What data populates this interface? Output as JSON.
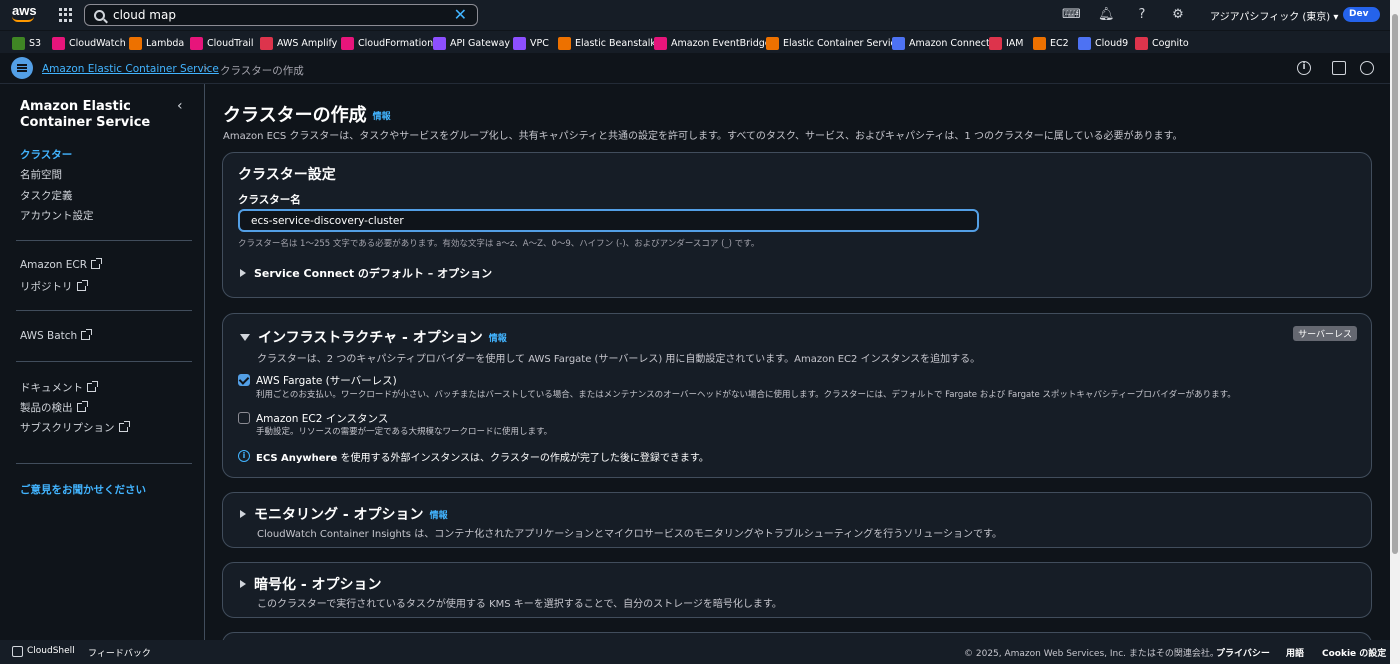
{
  "topnav": {
    "logo": "aws",
    "search_value": "cloud map",
    "region": "アジアパシフィック (東京) ▾",
    "account_badge": "Dev"
  },
  "favorites": [
    {
      "label": "S3",
      "color": "#3f8624"
    },
    {
      "label": "CloudWatch",
      "color": "#e7157b"
    },
    {
      "label": "Lambda",
      "color": "#ed7100"
    },
    {
      "label": "CloudTrail",
      "color": "#e7157b"
    },
    {
      "label": "AWS Amplify",
      "color": "#dd344c"
    },
    {
      "label": "CloudFormation",
      "color": "#e7157b"
    },
    {
      "label": "API Gateway",
      "color": "#8c4fff"
    },
    {
      "label": "VPC",
      "color": "#8c4fff"
    },
    {
      "label": "Elastic Beanstalk",
      "color": "#ed7100"
    },
    {
      "label": "Amazon EventBridge",
      "color": "#e7157b"
    },
    {
      "label": "Elastic Container Service",
      "color": "#ed7100"
    },
    {
      "label": "Amazon Connect",
      "color": "#4d72f3"
    },
    {
      "label": "IAM",
      "color": "#dd344c"
    },
    {
      "label": "EC2",
      "color": "#ed7100"
    },
    {
      "label": "Cloud9",
      "color": "#4d72f3"
    },
    {
      "label": "Cognito",
      "color": "#dd344c"
    }
  ],
  "breadcrumb": {
    "parent": "Amazon Elastic Container Service",
    "separator": "›",
    "current": "クラスターの作成"
  },
  "sidebar": {
    "title": "Amazon Elastic Container Service",
    "close": "‹",
    "items": [
      {
        "label": "クラスター"
      },
      {
        "label": "名前空間"
      },
      {
        "label": "タスク定義"
      },
      {
        "label": "アカウント設定"
      },
      {
        "label": "Amazon ECR"
      },
      {
        "label": "リポジトリ"
      },
      {
        "label": "AWS Batch"
      },
      {
        "label": "ドキュメント"
      },
      {
        "label": "製品の検出"
      },
      {
        "label": "サブスクリプション"
      }
    ],
    "feedback": "ご意見をお聞かせください"
  },
  "main": {
    "title": "クラスターの作成",
    "info": "情報",
    "description": "Amazon ECS クラスターは、タスクやサービスをグループ化し、共有キャパシティと共通の設定を許可します。すべてのタスク、サービス、およびキャパシティは、1 つのクラスターに属している必要があります。",
    "cluster_settings": {
      "title": "クラスター設定",
      "name_label": "クラスター名",
      "name_value": "ecs-service-discovery-cluster",
      "name_hint": "クラスター名は 1～255 文字である必要があります。有効な文字は a～z、A～Z、0～9、ハイフン (-)、およびアンダースコア (_) です。",
      "service_connect": "Service Connect のデフォルト – オプション"
    },
    "infra": {
      "title": "インフラストラクチャ - オプション",
      "info": "情報",
      "badge": "サーバーレス",
      "description": "クラスターは、2 つのキャパシティプロバイダーを使用して AWS Fargate (サーバーレス) 用に自動設定されています。Amazon EC2 インスタンスを追加する。",
      "fargate_label": "AWS Fargate (サーバーレス)",
      "fargate_desc": "利用ごとのお支払い。ワークロードが小さい、バッチまたはバーストしている場合、またはメンテナンスのオーバーヘッドがない場合に使用します。クラスターには、デフォルトで Fargate および Fargate スポットキャパシティープロバイダーがあります。",
      "fargate_checked": true,
      "ec2_label": "Amazon EC2 インスタンス",
      "ec2_desc": "手動設定。リソースの需要が一定である大規模なワークロードに使用します。",
      "ec2_checked": false,
      "anywhere_strong": "ECS Anywhere",
      "anywhere_text": " を使用する外部インスタンスは、クラスターの作成が完了した後に登録できます。"
    },
    "monitoring": {
      "title": "モニタリング - オプション",
      "info": "情報",
      "description": "CloudWatch Container Insights は、コンテナ化されたアプリケーションとマイクロサービスのモニタリングやトラブルシューティングを行うソリューションです。"
    },
    "encryption": {
      "title": "暗号化 - オプション",
      "description": "このクラスターで実行されているタスクが使用する KMS キーを選択することで、自分のストレージを暗号化します。"
    }
  },
  "footer": {
    "cloudshell": "CloudShell",
    "feedback": "フィードバック",
    "copyright": "© 2025, Amazon Web Services, Inc. またはその関連会社。",
    "privacy": "プライバシー",
    "terms": "用語",
    "cookie": "Cookie の設定"
  }
}
